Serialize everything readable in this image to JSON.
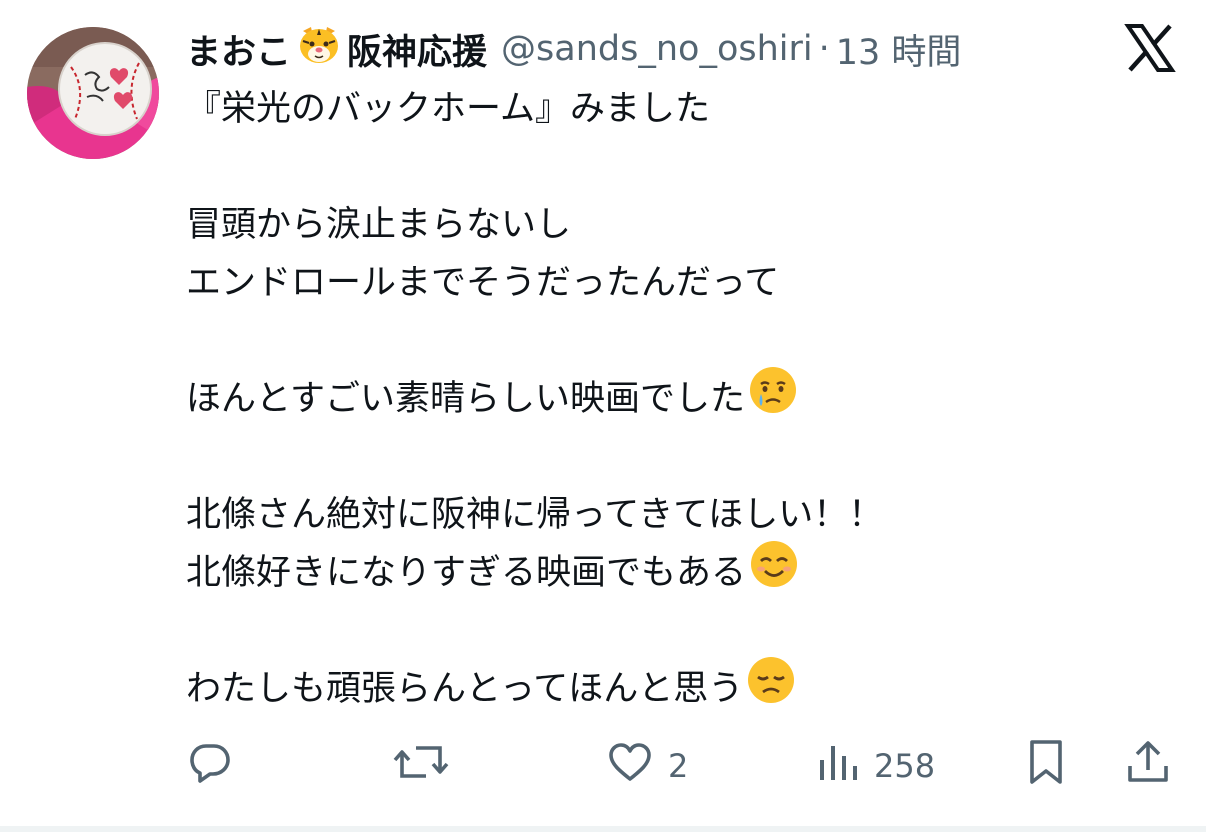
{
  "user": {
    "display_name": "まおこ",
    "display_name_suffix": "阪神応援",
    "badge_emoji": "tiger-face",
    "handle": "@sands_no_oshiri",
    "separator": "·",
    "timestamp": "13 時間"
  },
  "platform": {
    "logo": "x-logo"
  },
  "post": {
    "lines": [
      {
        "text": "『栄光のバックホーム』みました",
        "emoji": null
      },
      {
        "text": "",
        "emoji": null
      },
      {
        "text": "冒頭から涙止まらないし",
        "emoji": null
      },
      {
        "text": "エンドロールまでそうだったんだって",
        "emoji": null
      },
      {
        "text": "",
        "emoji": null
      },
      {
        "text": "ほんとすごい素晴らしい映画でした",
        "emoji": "crying-face"
      },
      {
        "text": "",
        "emoji": null
      },
      {
        "text": "北條さん絶対に阪神に帰ってきてほしい！！",
        "emoji": null
      },
      {
        "text": "北條好きになりすぎる映画でもある",
        "emoji": "smiling-face-with-smiling-eyes"
      },
      {
        "text": "",
        "emoji": null
      },
      {
        "text": "わたしも頑張らんとってほんと思う",
        "emoji": "disappointed-face"
      }
    ]
  },
  "actions": {
    "reply": {
      "icon": "reply-icon",
      "count": ""
    },
    "repost": {
      "icon": "repost-icon",
      "count": ""
    },
    "like": {
      "icon": "heart-icon",
      "count": "2"
    },
    "views": {
      "icon": "views-icon",
      "count": "258"
    },
    "bookmark": {
      "icon": "bookmark-icon"
    },
    "share": {
      "icon": "share-icon"
    }
  },
  "colors": {
    "text": "#0f1419",
    "secondary": "#536471",
    "background": "#ffffff",
    "avatar_pink": "#e8358f"
  }
}
